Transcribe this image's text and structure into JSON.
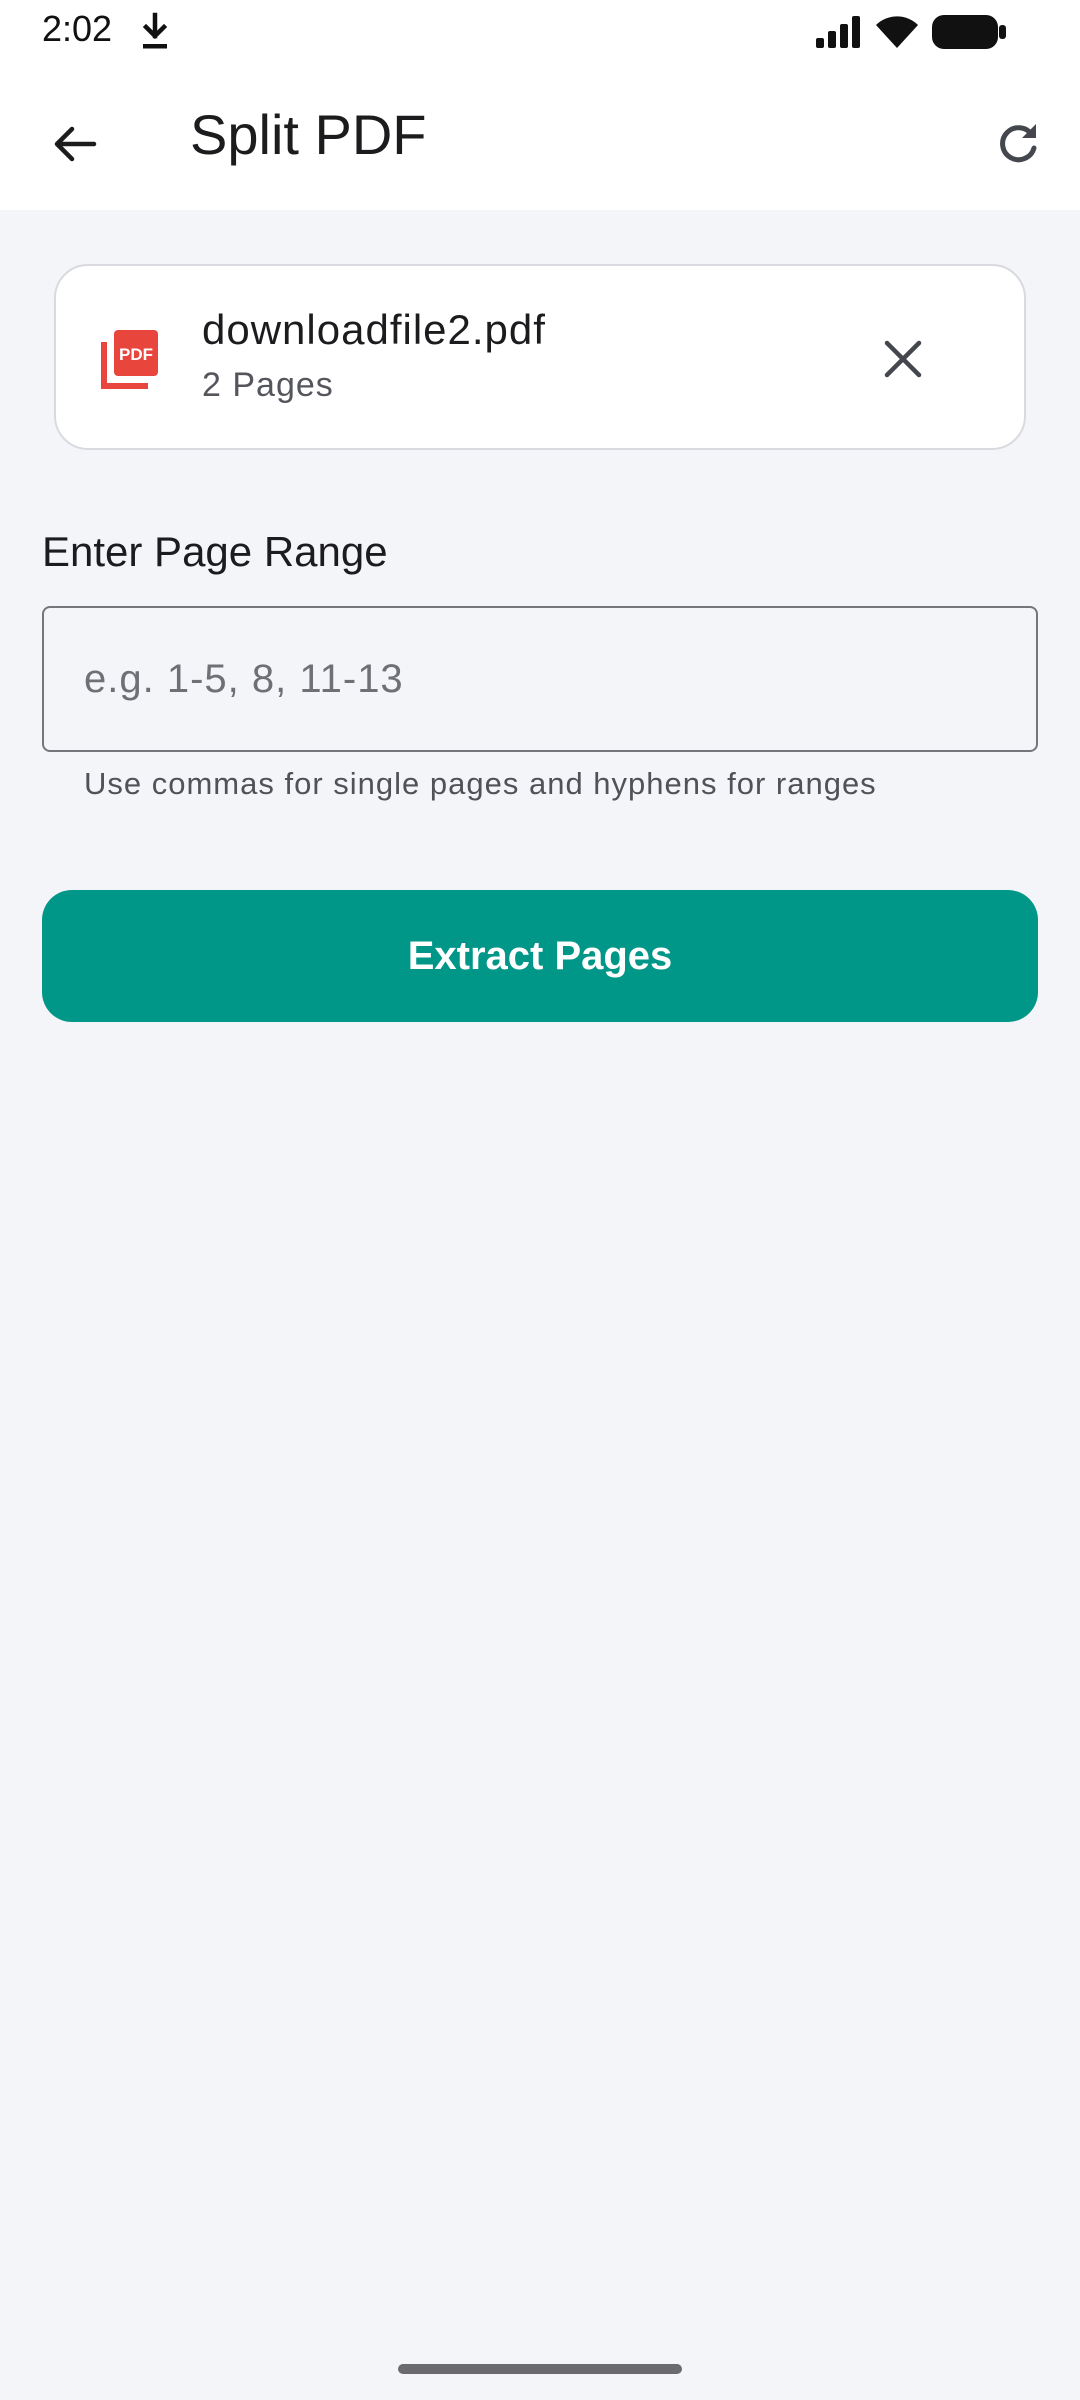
{
  "status_bar": {
    "time": "2:02"
  },
  "app_bar": {
    "title": "Split PDF"
  },
  "file_card": {
    "file_name": "downloadfile2.pdf",
    "page_count": "2 Pages",
    "pdf_badge": "PDF"
  },
  "page_range": {
    "label": "Enter Page Range",
    "value": "",
    "placeholder": "e.g. 1-5, 8, 11-13",
    "helper": "Use commas for single pages and hyphens for ranges"
  },
  "actions": {
    "extract_label": "Extract Pages"
  },
  "icons": {
    "download": "download-icon",
    "signal": "signal-icon",
    "wifi": "wifi-icon",
    "battery": "battery-icon",
    "back": "arrow-back-icon",
    "refresh": "refresh-icon",
    "pdf": "pdf-file-icon",
    "close": "close-icon"
  },
  "colors": {
    "accent": "#009688",
    "pdf_red": "#e8453c",
    "background": "#f4f5f9"
  }
}
